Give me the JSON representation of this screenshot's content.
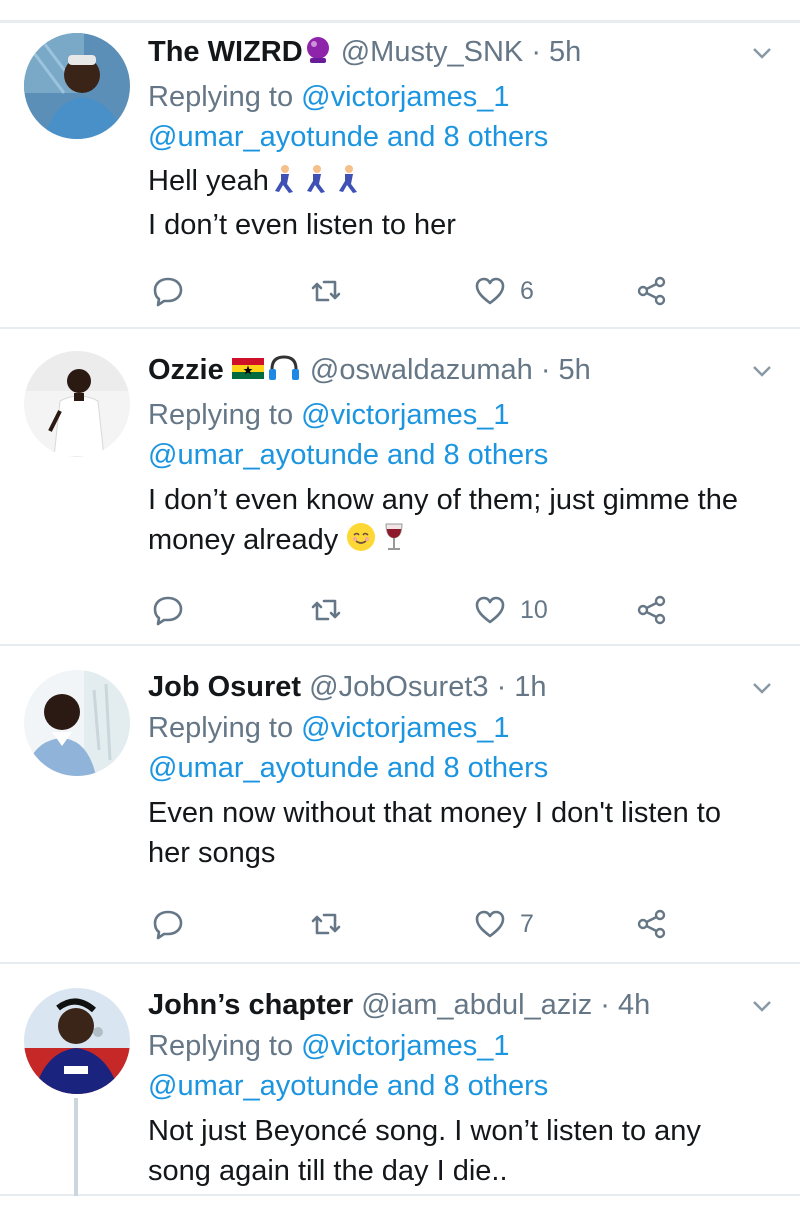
{
  "replying_prefix": "Replying to",
  "tweets": [
    {
      "display_name": "The WIZRD",
      "name_emoji": "crystal-ball-emoji",
      "handle": "@Musty_SNK",
      "time": "· 5h",
      "reply_to_primary": "@victorjames_1",
      "reply_to_secondary": "@umar_ayotunde and 8 others",
      "text_lines": [
        "Hell yeah",
        "I don’t even listen to her"
      ],
      "likes": "6"
    },
    {
      "display_name": "Ozzie",
      "name_emoji": "ghana-flag-headphones-emoji",
      "handle": "@oswaldazumah",
      "time": "· 5h",
      "reply_to_primary": "@victorjames_1",
      "reply_to_secondary": "@umar_ayotunde and 8 others",
      "text_lines": [
        "I don’t even know any of them; just gimme the",
        "money already"
      ],
      "likes": "10"
    },
    {
      "display_name": "Job Osuret",
      "handle": "@JobOsuret3",
      "time": "· 1h",
      "reply_to_primary": "@victorjames_1",
      "reply_to_secondary": "@umar_ayotunde and 8 others",
      "text_lines": [
        "Even now without that money I don't listen to",
        "her songs"
      ],
      "likes": "7"
    },
    {
      "display_name": "John’s chapter",
      "handle": "@iam_abdul_aziz",
      "time": "· 4h",
      "reply_to_primary": "@victorjames_1",
      "reply_to_secondary": "@umar_ayotunde and 8 others",
      "text_lines": [
        "Not just Beyoncé song. I won’t listen to any",
        "song again till the day I die.."
      ]
    }
  ],
  "colors": {
    "link": "#1b95e0",
    "secondary_text": "#657786",
    "primary_text": "#14171a",
    "divider": "#e6ecf0"
  },
  "icons": [
    "reply-icon",
    "retweet-icon",
    "like-icon",
    "share-icon",
    "chevron-down-icon"
  ]
}
